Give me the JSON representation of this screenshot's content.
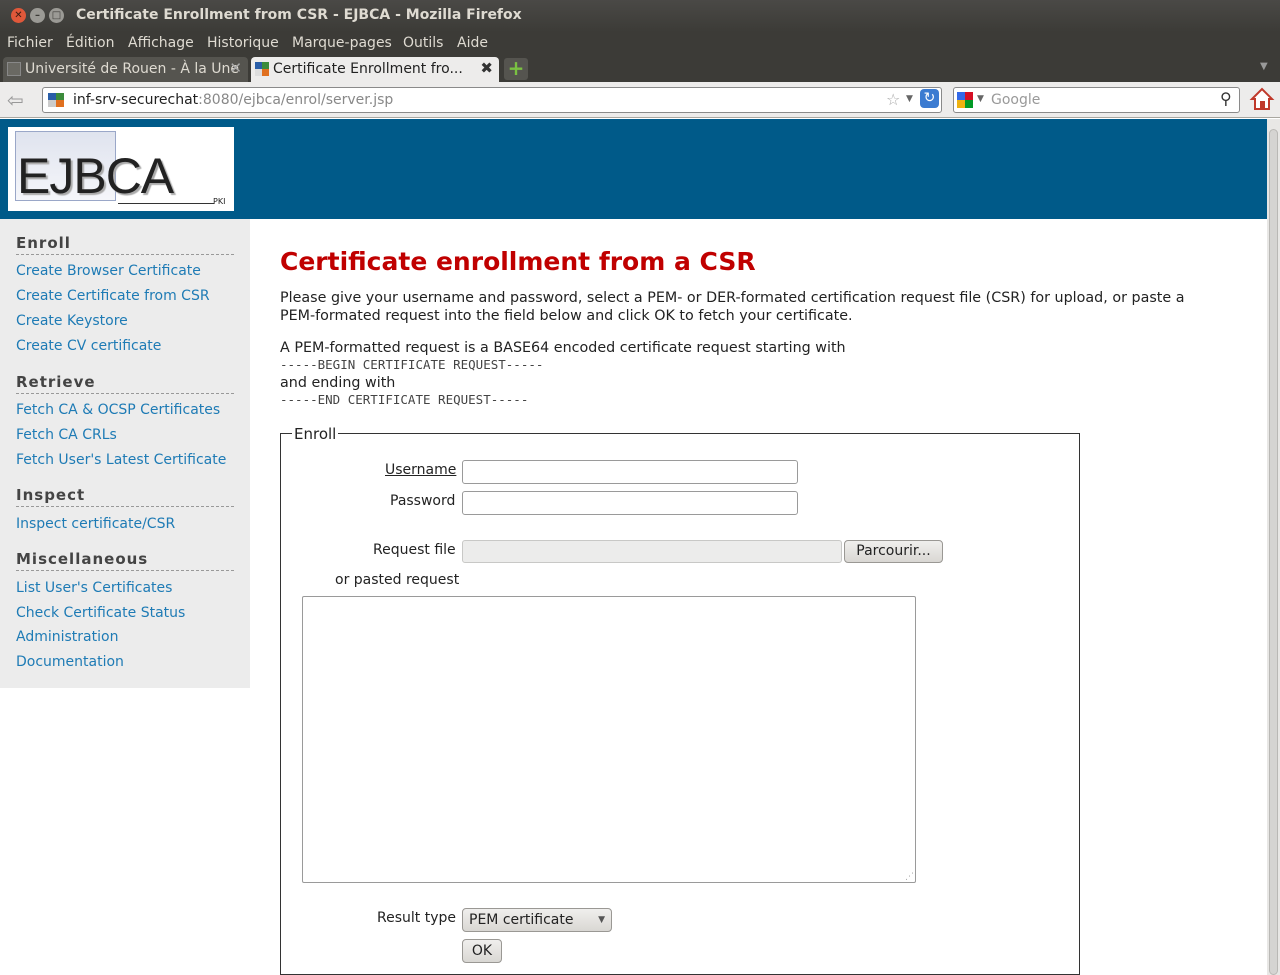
{
  "window": {
    "title": "Certificate Enrollment from CSR - EJBCA - Mozilla Firefox"
  },
  "menu": [
    "Fichier",
    "Édition",
    "Affichage",
    "Historique",
    "Marque-pages",
    "Outils",
    "Aide"
  ],
  "tabs": [
    {
      "label": "Université de Rouen - À la Une",
      "active": false
    },
    {
      "label": "Certificate Enrollment fro...",
      "active": true
    }
  ],
  "nav": {
    "url_host": "inf-srv-securechat",
    "url_rest": ":8080/ejbca/enrol/server.jsp",
    "search_placeholder": "Google"
  },
  "logo": {
    "text": "EJBCA",
    "sub": "PKI"
  },
  "sidebar": {
    "sections": [
      {
        "title": "Enroll",
        "items": [
          "Create Browser Certificate",
          "Create Certificate from CSR",
          "Create Keystore",
          "Create CV certificate"
        ]
      },
      {
        "title": "Retrieve",
        "items": [
          "Fetch CA & OCSP Certificates",
          "Fetch CA CRLs",
          "Fetch User's Latest Certificate"
        ]
      },
      {
        "title": "Inspect",
        "items": [
          "Inspect certificate/CSR"
        ]
      },
      {
        "title": "Miscellaneous",
        "items": [
          "List User's Certificates",
          "Check Certificate Status",
          "Administration",
          "Documentation"
        ]
      }
    ]
  },
  "main": {
    "title": "Certificate enrollment from a CSR",
    "intro_line1": "Please give your username and password, select a PEM- or DER-formated certification request file (CSR) for upload, or paste a",
    "intro_line2": "PEM-formated request into the field below and click OK to fetch your certificate.",
    "pem_intro": "A PEM-formatted request is a BASE64 encoded certificate request starting with",
    "pem_begin": "-----BEGIN CERTIFICATE REQUEST-----",
    "pem_and": "and ending with",
    "pem_end": "-----END CERTIFICATE REQUEST-----"
  },
  "form": {
    "legend": "Enroll",
    "username_label": "Username",
    "password_label": "Password",
    "request_file_label": "Request file",
    "browse_button": "Parcourir...",
    "pasted_label": "or pasted request",
    "result_type_label": "Result type",
    "result_type_value": "PEM certificate",
    "ok_button": "OK"
  },
  "colors": {
    "header_bg": "#005a89",
    "title_red": "#c00000",
    "link_blue": "#1e7bb5",
    "sidebar_bg": "#ececec"
  }
}
